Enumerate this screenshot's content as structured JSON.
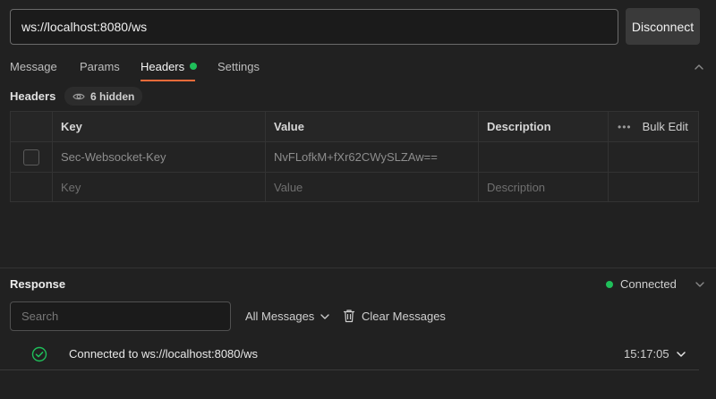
{
  "request": {
    "url": "ws://localhost:8080/ws",
    "disconnect_label": "Disconnect"
  },
  "tabs": [
    {
      "label": "Message"
    },
    {
      "label": "Params"
    },
    {
      "label": "Headers",
      "active": true,
      "indicator": "green-dot"
    },
    {
      "label": "Settings"
    }
  ],
  "headers": {
    "title": "Headers",
    "hidden_count_label": "6 hidden",
    "columns": {
      "key": "Key",
      "value": "Value",
      "description": "Description",
      "bulk_edit": "Bulk Edit"
    },
    "rows": [
      {
        "key": "Sec-Websocket-Key",
        "value": "NvFLofkM+fXr62CWySLZAw==",
        "description": ""
      }
    ],
    "new_row": {
      "key_placeholder": "Key",
      "value_placeholder": "Value",
      "description_placeholder": "Description"
    }
  },
  "response": {
    "title": "Response",
    "status": "Connected",
    "search_placeholder": "Search",
    "filter_label": "All Messages",
    "clear_label": "Clear Messages",
    "messages": [
      {
        "text": "Connected to ws://localhost:8080/ws",
        "time": "15:17:05",
        "icon": "check-circle-icon"
      }
    ]
  },
  "colors": {
    "accent": "#f26b3a",
    "connected": "#1fbf5a",
    "background": "#212121"
  }
}
